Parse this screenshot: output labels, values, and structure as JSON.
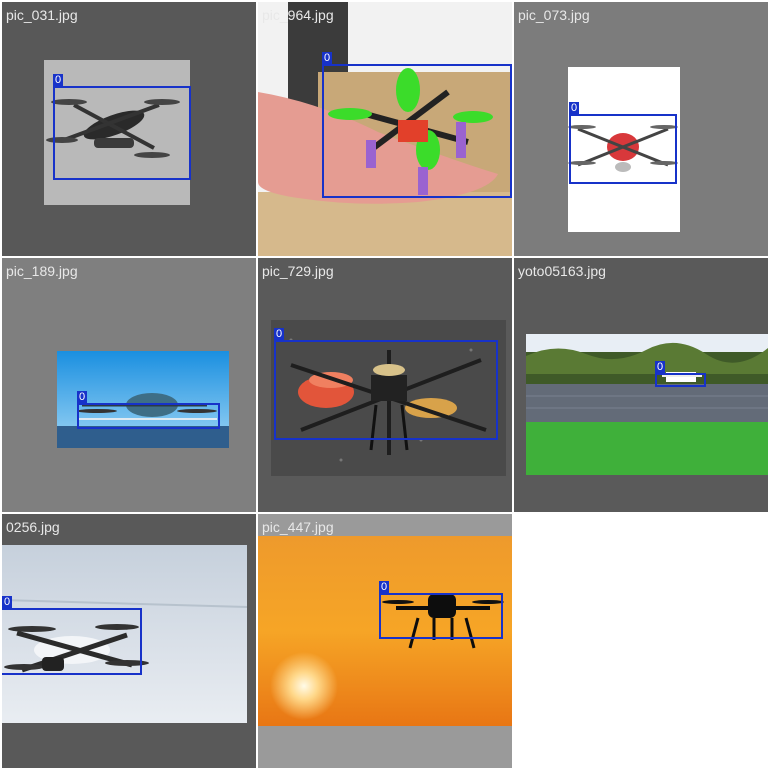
{
  "grid": {
    "tiles": [
      {
        "filename": "pic_031.jpg",
        "label": "0"
      },
      {
        "filename": "pic_964.jpg",
        "label": "0"
      },
      {
        "filename": "pic_073.jpg",
        "label": "0"
      },
      {
        "filename": "pic_189.jpg",
        "label": "0"
      },
      {
        "filename": "pic_729.jpg",
        "label": "0"
      },
      {
        "filename": "yoto05163.jpg",
        "label": "0"
      },
      {
        "filename": "0256.jpg",
        "label": "0"
      },
      {
        "filename": "pic_447.jpg",
        "label": "0"
      }
    ]
  },
  "colors": {
    "box": "#1732c9",
    "tile_gray": "#595959",
    "tile_gray_light": "#7f7f7f"
  }
}
